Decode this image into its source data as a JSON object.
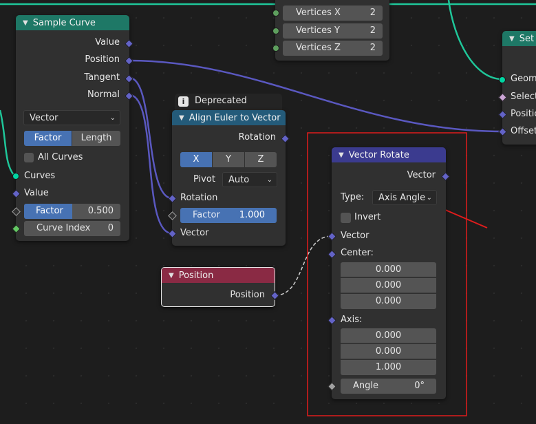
{
  "vertices_node": {
    "vertices_x_label": "Vertices X",
    "vertices_x_value": "2",
    "vertices_y_label": "Vertices Y",
    "vertices_y_value": "2",
    "vertices_z_label": "Vertices Z",
    "vertices_z_value": "2"
  },
  "sample_curve": {
    "title": "Sample Curve",
    "out_value": "Value",
    "out_position": "Position",
    "out_tangent": "Tangent",
    "out_normal": "Normal",
    "data_type": "Vector",
    "mode_factor": "Factor",
    "mode_length": "Length",
    "all_curves": "All Curves",
    "in_curves": "Curves",
    "in_value": "Value",
    "factor_label": "Factor",
    "factor_value": "0.500",
    "curve_index_label": "Curve Index",
    "curve_index_value": "0"
  },
  "align_euler": {
    "badge": "Deprecated",
    "title": "Align Euler to Vector",
    "out_rotation": "Rotation",
    "axis_x": "X",
    "axis_y": "Y",
    "axis_z": "Z",
    "pivot_label": "Pivot",
    "pivot_value": "Auto",
    "in_rotation": "Rotation",
    "factor_label": "Factor",
    "factor_value": "1.000",
    "in_vector": "Vector"
  },
  "position_node": {
    "title": "Position",
    "out_position": "Position"
  },
  "vector_rotate": {
    "title": "Vector Rotate",
    "out_vector": "Vector",
    "type_label": "Type:",
    "type_value": "Axis Angle",
    "invert_label": "Invert",
    "in_vector": "Vector",
    "center_label": "Center:",
    "center_x": "0.000",
    "center_y": "0.000",
    "center_z": "0.000",
    "axis_label": "Axis:",
    "axis_x": "0.000",
    "axis_y": "0.000",
    "axis_z": "1.000",
    "angle_label": "Angle",
    "angle_value": "0°"
  },
  "set_position": {
    "title": "Set",
    "in_geometry": "Geom",
    "in_selection": "Select",
    "in_position": "Positio",
    "in_offset": "Offset"
  },
  "colors": {
    "geometry_header": "#1e7866",
    "vector_header": "#3b3b8f",
    "input_header": "#8a2a44",
    "convert_header": "#245b7a",
    "highlight": "#e01c1c",
    "vector_socket": "#6363c7",
    "geometry_socket": "#00d6a3"
  }
}
